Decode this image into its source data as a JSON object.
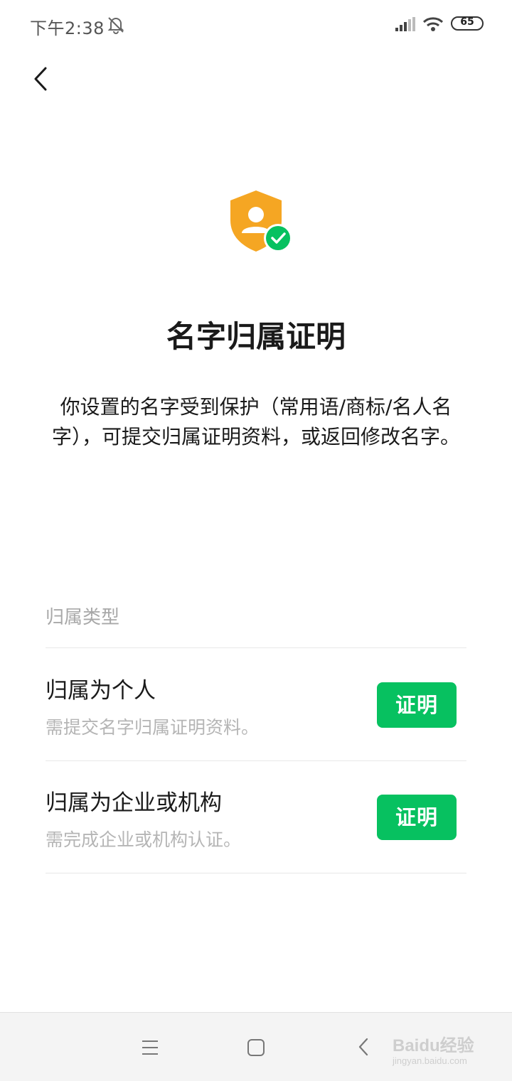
{
  "status_bar": {
    "time": "下午2:38",
    "battery": "65",
    "icons": [
      "bell-off-icon",
      "signal-icon",
      "wifi-icon",
      "battery-icon"
    ]
  },
  "header": {
    "back_icon": "chevron-left-icon"
  },
  "hero": {
    "icon": "shield-user-check-icon",
    "title": "名字归属证明",
    "description": "你设置的名字受到保护（常用语/商标/名人名字），可提交归属证明资料，或返回修改名字。"
  },
  "section": {
    "label": "归属类型",
    "options": [
      {
        "title": "归属为个人",
        "subtitle": "需提交名字归属证明资料。",
        "button": "证明"
      },
      {
        "title": "归属为企业或机构",
        "subtitle": "需完成企业或机构认证。",
        "button": "证明"
      }
    ]
  },
  "bottom_nav": {
    "items": [
      "menu-icon",
      "home-icon",
      "back-icon"
    ],
    "watermark_logo": "Baidu经验",
    "watermark_url": "jingyan.baidu.com"
  },
  "colors": {
    "accent": "#07c160",
    "shield": "#f5a623",
    "text_primary": "#1a1a1a",
    "text_secondary": "#b5b5b5"
  }
}
